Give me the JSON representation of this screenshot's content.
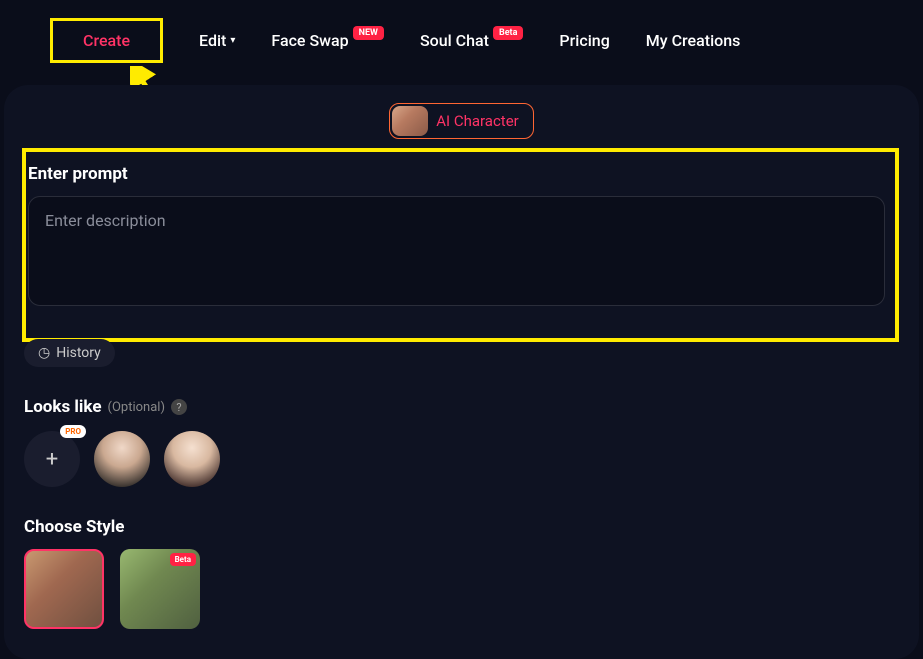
{
  "nav": {
    "create": "Create",
    "edit": "Edit",
    "faceSwap": "Face Swap",
    "faceSwapBadge": "NEW",
    "soulChat": "Soul Chat",
    "soulChatBadge": "Beta",
    "pricing": "Pricing",
    "myCreations": "My Creations"
  },
  "aiCharacter": "AI Character",
  "prompt": {
    "title": "Enter prompt",
    "placeholder": "Enter description"
  },
  "history": "History",
  "looksLike": {
    "title": "Looks like",
    "optional": "(Optional)",
    "proBadge": "PRO"
  },
  "chooseStyle": {
    "title": "Choose Style",
    "betaBadge": "Beta"
  }
}
